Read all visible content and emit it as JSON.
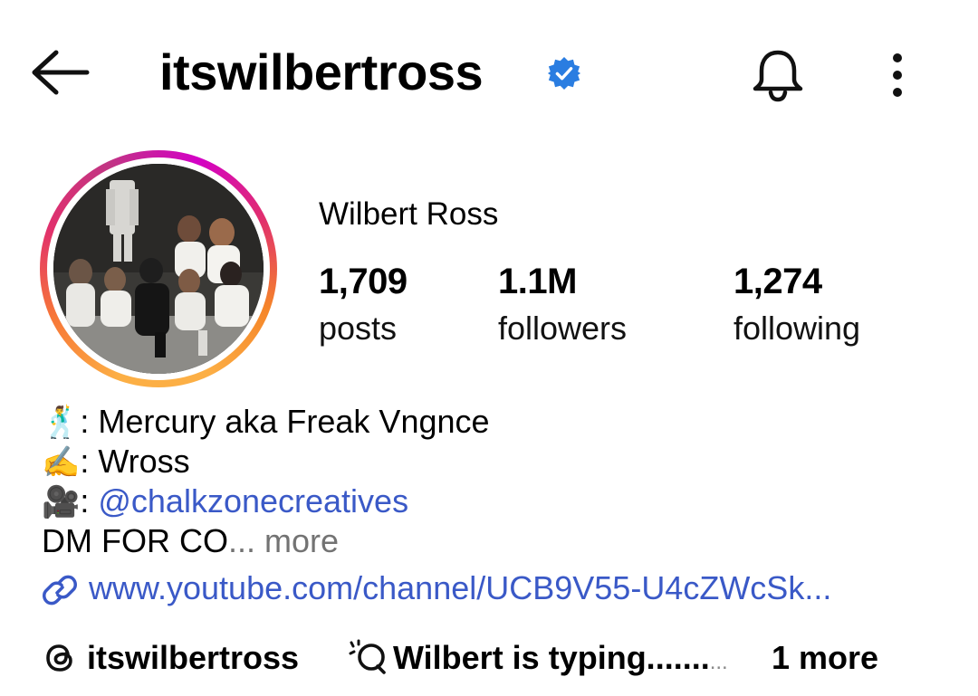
{
  "header": {
    "username": "itswilbertross",
    "verified_color": "#2a7de1"
  },
  "profile": {
    "display_name": "Wilbert Ross",
    "stats": {
      "posts_count": "1,709",
      "posts_label": "posts",
      "followers_count": "1.1M",
      "followers_label": "followers",
      "following_count": "1,274",
      "following_label": "following"
    }
  },
  "bio": {
    "line1_emoji": "🕺",
    "line1_text": ": Mercury aka Freak Vngnce",
    "line2_emoji": "✍️",
    "line2_text": ": Wross",
    "line3_emoji": "🎥",
    "line3_sep": ": ",
    "line3_mention": "@chalkzonecreatives",
    "line4_text": "DM FOR CO",
    "line4_ellipsis": "...",
    "line4_more": " more",
    "link": "www.youtube.com/channel/UCB9V55-U4cZWcSk..."
  },
  "chips": {
    "threads_label": "itswilbertross",
    "note_label": "Wilbert is typing.......",
    "note_dots": "...",
    "more_label": "1 more"
  },
  "icons": {
    "back": "arrow-left-icon",
    "verified": "verified-badge-icon",
    "bell": "bell-icon",
    "more": "vertical-dots-icon",
    "link": "link-icon",
    "threads": "threads-icon",
    "note": "speech-bubbles-icon"
  },
  "colors": {
    "link_blue": "#3a59c7",
    "muted_gray": "#737373"
  }
}
